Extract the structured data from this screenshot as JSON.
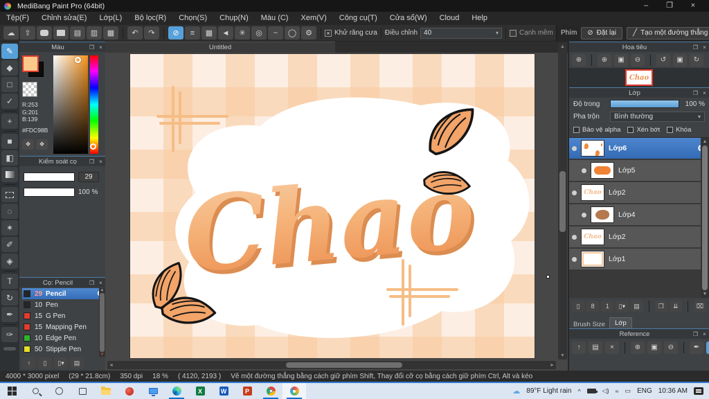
{
  "window": {
    "title": "MediBang Paint Pro (64bit)"
  },
  "icons": {
    "minimize": "–",
    "restore": "❐",
    "close": "×",
    "cloud": "☁",
    "export": "⇧",
    "document": "▤",
    "form": "▥",
    "grid_doc": "▦",
    "undo": "↶",
    "redo": "↷",
    "snap_off": "⊘",
    "snap_parallel": "≡",
    "snap_grid": "▦",
    "snap_vanishing": "◄",
    "snap_radial": "✳",
    "snap_concentric": "◎",
    "snap_curve": "~",
    "snap_ellipse": "◯",
    "snap_settings": "⚙",
    "check_x": "×",
    "dropdown": "▾",
    "reset_slash": "⊘",
    "line_pen": "╱",
    "tool_brush": "✎",
    "tool_eraser": "◆",
    "tool_shape": "□",
    "tool_control": "✓",
    "tool_move": "+",
    "tool_fill": "■",
    "tool_bucket": "◧",
    "tool_lasso": "◌",
    "tool_wand": "✶",
    "tool_select_pen": "✐",
    "tool_select_eraser": "◈",
    "tool_text": "T",
    "tool_rotate": "↻",
    "tool_eyedropper": "✒",
    "tool_divide": "✑",
    "panel_popout": "❐",
    "panel_close": "×",
    "palette": "❖",
    "zoom_actual": "⊕",
    "zoom_in": "⊕",
    "zoom_fit": "▣",
    "zoom_out": "⊖",
    "rotate_left": "↺",
    "rotate_reset": "▣",
    "rotate_right": "↻",
    "rotate_lock": "⊙",
    "gear": "⚙",
    "layer_new": "▯",
    "layer_8bit": "8",
    "layer_1bit": "1",
    "layer_add": "▯▾",
    "folder": "▤",
    "duplicate": "❐",
    "merge_down": "⇊",
    "trash": "⌧",
    "brush_cloud": "↑",
    "brush_new": "▯",
    "brush_new_menu": "▯▾",
    "brush_script": "▤",
    "ref_upload": "↑",
    "ref_close": "×",
    "ref_dropper": "✒",
    "ref_hand": "✋",
    "scroll_up": "▲",
    "scroll_down": "▼",
    "scroll_left": "◄",
    "scroll_right": "►",
    "tray_chevron": "^",
    "weather_cloud": "☁"
  },
  "menu": {
    "items": [
      "Tệp(F)",
      "Chỉnh sửa(E)",
      "Lớp(L)",
      "Bộ lọc(R)",
      "Chọn(S)",
      "Chụp(N)",
      "Màu (C)",
      "Xem(V)",
      "Công cụ(T)",
      "Cửa sổ(W)",
      "Cloud",
      "Help"
    ]
  },
  "toolbar": {
    "antialias": "Khử răng cưa",
    "adjust_label": "Điều chỉnh",
    "adjust_value": "40",
    "soft_edge": "Cạnh mềm",
    "key_label": "Phím",
    "reset": "Đặt lại",
    "straight_line": "Tạo một đường thẳng"
  },
  "color_panel": {
    "title": "Màu",
    "r": "R:253",
    "g": "G:201",
    "b": "B:139",
    "hex": "#FDC98B",
    "foreground": "#FDC98B"
  },
  "brush_control": {
    "title": "Kiểm soát cọ",
    "size": "29",
    "opacity": "100 %"
  },
  "brush_panel": {
    "title": "Cọ: Pencil",
    "brushes": [
      {
        "size": "29",
        "name": "Pencil",
        "color": "#262626",
        "selected": true
      },
      {
        "size": "10",
        "name": "Pen",
        "color": "#262626",
        "selected": false
      },
      {
        "size": "15",
        "name": "G Pen",
        "color": "#e23b2e",
        "selected": false
      },
      {
        "size": "15",
        "name": "Mapping Pen",
        "color": "#e23b2e",
        "selected": false
      },
      {
        "size": "10",
        "name": "Edge Pen",
        "color": "#2eb52c",
        "selected": false
      },
      {
        "size": "50",
        "name": "Stipple Pen",
        "color": "#e5df2a",
        "selected": false
      }
    ]
  },
  "canvas": {
    "tab": "Untitled",
    "word": "Chao"
  },
  "navigator": {
    "title": "Hoa tiêu"
  },
  "layers": {
    "title": "Lớp",
    "opacity_label": "Độ trong",
    "opacity_value": "100 %",
    "blend_label": "Pha trộn",
    "blend_value": "Bình thường",
    "alpha_lock": "Bảo vệ alpha",
    "clipping": "Xén bớt",
    "lock": "Khóa",
    "items": [
      {
        "name": "Lớp6",
        "selected": true,
        "clipped": false
      },
      {
        "name": "Lớp5",
        "selected": false,
        "clipped": true
      },
      {
        "name": "Lớp2",
        "selected": false,
        "clipped": false
      },
      {
        "name": "Lớp4",
        "selected": false,
        "clipped": true
      },
      {
        "name": "Lớp2",
        "selected": false,
        "clipped": false
      },
      {
        "name": "Lớp1",
        "selected": false,
        "clipped": false
      }
    ],
    "tabs": [
      "Brush Size",
      "Lớp"
    ]
  },
  "reference": {
    "title": "Reference"
  },
  "status": {
    "size": "4000 * 3000 pixel",
    "print_size": "(29 * 21.8cm)",
    "dpi": "350 dpi",
    "zoom": "18 %",
    "coords": "( 4120, 2193 )",
    "hint": "Vẽ một đường thẳng bằng cách giữ phím Shift, Thay đổi cỡ cọ bằng cách giữ phím Ctrl, Alt và kéo"
  },
  "taskbar": {
    "weather": "89°F Light rain",
    "language": "ENG",
    "time": "10:36 AM"
  },
  "colors": {
    "accent_blue": "#57a0d9",
    "selection_blue": "#3c76c0",
    "canvas_orange": "#f2a469",
    "foreground_swatch": "#FDC98B"
  }
}
